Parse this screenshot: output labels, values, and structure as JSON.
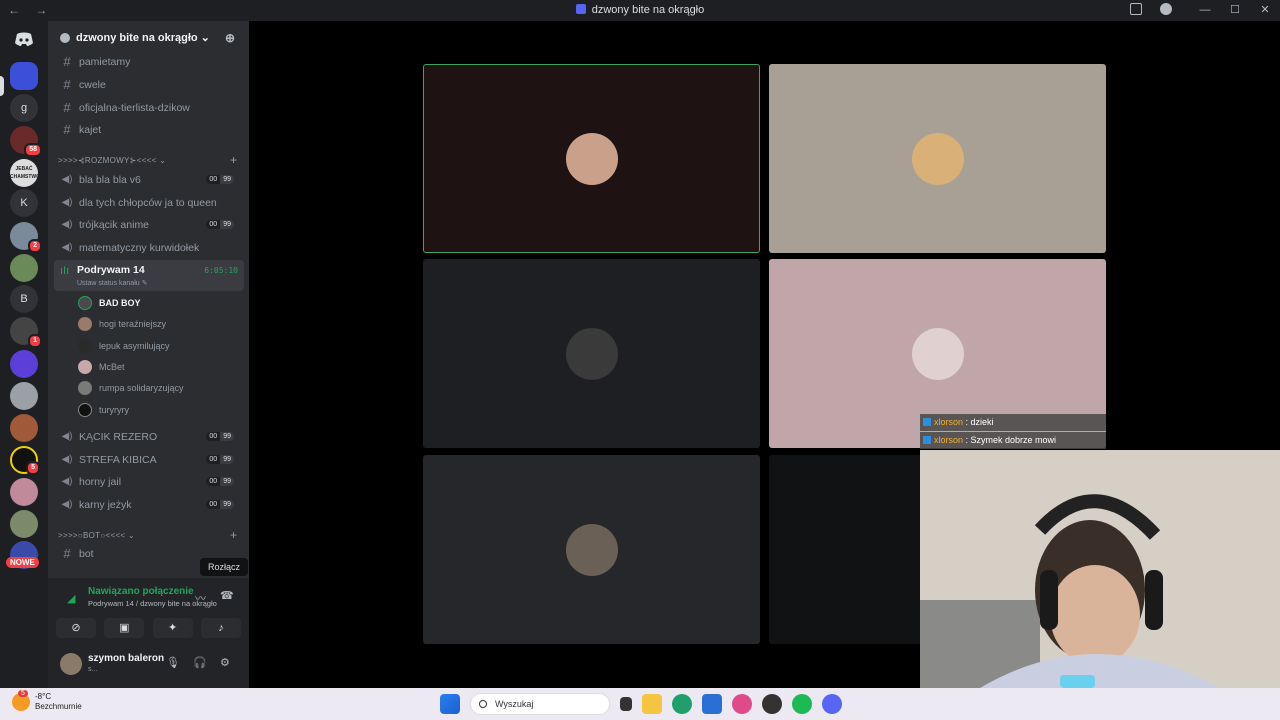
{
  "window": {
    "title": "dzwony bite na okrągło",
    "nav_arrows": "← →",
    "controls": [
      "—",
      "☐",
      "✕"
    ]
  },
  "guilds": {
    "home_icon": "discord-logo-icon",
    "letters": [
      "g",
      "K",
      "B"
    ],
    "badges": [
      "58",
      "2",
      "1",
      "5"
    ],
    "new_label": "NOWE",
    "selected_guild_logo_text": [
      "JEBAĆ",
      "CHAMSTWO"
    ]
  },
  "server": {
    "name": "dzwony bite na okrągło ⌄",
    "text_channels": [
      "pamietamy",
      "cwele",
      "oficjalna-tierlista-dzikow",
      "kajet"
    ],
    "voice_category": ">>>>⊰ROZMOWY⊱<<<< ⌄",
    "voice_channels_top": [
      {
        "name": "bla bla bla v6",
        "count": "00",
        "limit": "99"
      },
      {
        "name": "dla tych chłopców ja to queen",
        "count": "",
        "limit": ""
      },
      {
        "name": "trójkącik anime",
        "count": "00",
        "limit": "99"
      },
      {
        "name": "matematyczny kurwidołek",
        "count": "",
        "limit": ""
      }
    ],
    "active_channel": {
      "name": "Podrywam 14",
      "status": "Ustaw status kanału ✎",
      "time": "6:05:10"
    },
    "voice_users": [
      "BAD BOY",
      "hogi teraźniejszy",
      "lepuk asymilujący",
      "McBet",
      "rumpa solidaryzujący",
      "turyryry"
    ],
    "voice_channels_bottom": [
      {
        "name": "KĄCIK REZERO",
        "count": "00",
        "limit": "99"
      },
      {
        "name": "STREFA KIBICA",
        "count": "00",
        "limit": "99"
      },
      {
        "name": "horny jail",
        "count": "00",
        "limit": "99"
      },
      {
        "name": "karny jeżyk",
        "count": "00",
        "limit": "99"
      }
    ],
    "bot_category": ">>>>○BOT○<<<< ⌄",
    "bot_channel": "bot"
  },
  "tooltip": "Rozłącz",
  "voice_panel": {
    "status": "Nawiązano połączenie",
    "channel": "Podrywam 14 / dzwony bite na okrągło"
  },
  "user_panel": {
    "username": "szymon baleron",
    "status": "s..."
  },
  "stream_chat": [
    {
      "user": "xlorson",
      "text": " : dzieki"
    },
    {
      "user": "xlorson",
      "text": " : Szymek dobrze mowi"
    }
  ],
  "taskbar": {
    "temperature": "-8°C",
    "weather": "Bezchmurnie",
    "weather_badge": "5",
    "search_placeholder": "Wyszukaj"
  }
}
